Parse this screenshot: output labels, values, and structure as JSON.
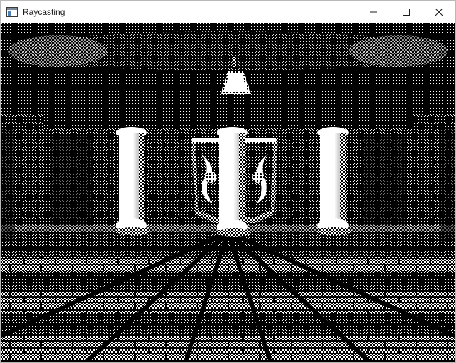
{
  "window": {
    "title": "Raycasting",
    "controls": [
      "minimize",
      "maximize",
      "close"
    ]
  },
  "icons": {
    "app": "app-window-icon",
    "minimize": "minimize-icon",
    "maximize": "maximize-icon",
    "close": "close-icon"
  },
  "scene": {
    "style": "1-bit dithered",
    "colors": {
      "dark": "#000000",
      "light": "#ffffff"
    }
  }
}
